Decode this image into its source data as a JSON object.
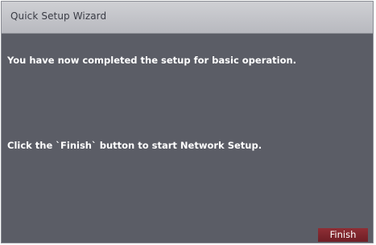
{
  "window": {
    "title": "Quick Setup Wizard"
  },
  "content": {
    "message_completed": "You have now completed the setup for basic operation.",
    "message_instruction": "Click the `Finish` button to start Network Setup."
  },
  "buttons": {
    "finish_label": "Finish"
  },
  "colors": {
    "dialog_background": "#5b5d66",
    "titlebar_background": "#c4c5ca",
    "finish_button": "#7d2830"
  }
}
